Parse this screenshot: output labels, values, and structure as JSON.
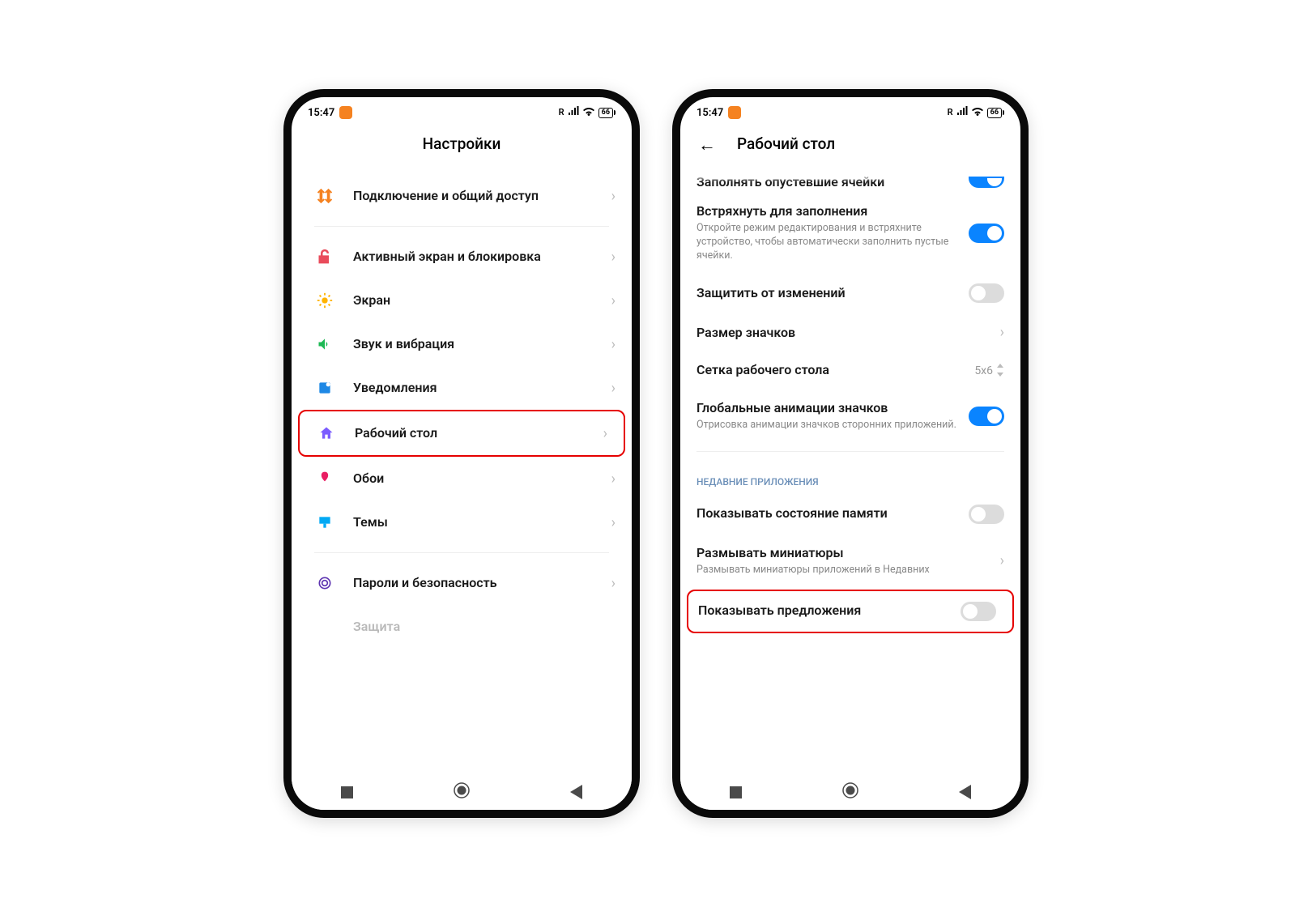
{
  "status": {
    "time": "15:47",
    "signal_type": "R",
    "battery": "66"
  },
  "screen1": {
    "title": "Настройки",
    "items": {
      "connection": "Подключение и общий доступ",
      "lockscreen": "Активный экран и блокировка",
      "display": "Экран",
      "sound": "Звук и вибрация",
      "notifications": "Уведомления",
      "desktop": "Рабочий стол",
      "wallpaper": "Обои",
      "themes": "Темы",
      "security": "Пароли и безопасность",
      "cutoff": "Защита"
    }
  },
  "screen2": {
    "title": "Рабочий стол",
    "cutoff_top": "Заполнять опустевшие ячейки",
    "shake": {
      "title": "Встряхнуть для заполнения",
      "sub": "Откройте режим редактирования и встряхните устройство, чтобы автоматически заполнить пустые ячейки."
    },
    "protect": "Защитить от изменений",
    "icon_size": "Размер значков",
    "grid": {
      "title": "Сетка рабочего стола",
      "value": "5x6"
    },
    "global_anim": {
      "title": "Глобальные анимации значков",
      "sub": "Отрисовка анимации значков сторонних приложений."
    },
    "section_recent": "НЕДАВНИЕ ПРИЛОЖЕНИЯ",
    "memory": "Показывать состояние памяти",
    "blur": {
      "title": "Размывать миниатюры",
      "sub": "Размывать миниатюры приложений в Недавних"
    },
    "suggestions": "Показывать предложения"
  }
}
